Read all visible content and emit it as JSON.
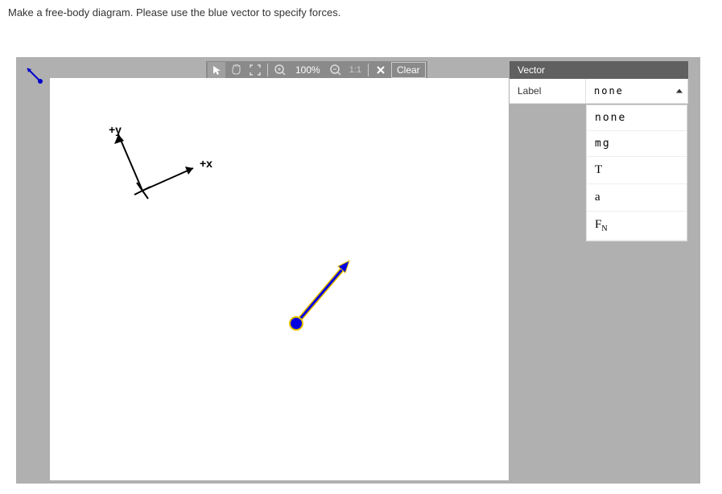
{
  "instruction": "Make a free-body diagram. Please use the blue vector to specify forces.",
  "toolbar": {
    "zoom_level": "100%",
    "ratio": "1:1",
    "clear_label": "Clear"
  },
  "panel": {
    "header": "Vector",
    "label_field": "Label",
    "selected_value": "none",
    "options": {
      "none": "none",
      "mg": "mg",
      "T": "T",
      "a": "a",
      "FN_base": "F",
      "FN_sub": "N"
    }
  },
  "axes": {
    "y_label": "+y",
    "x_label": "+x"
  }
}
